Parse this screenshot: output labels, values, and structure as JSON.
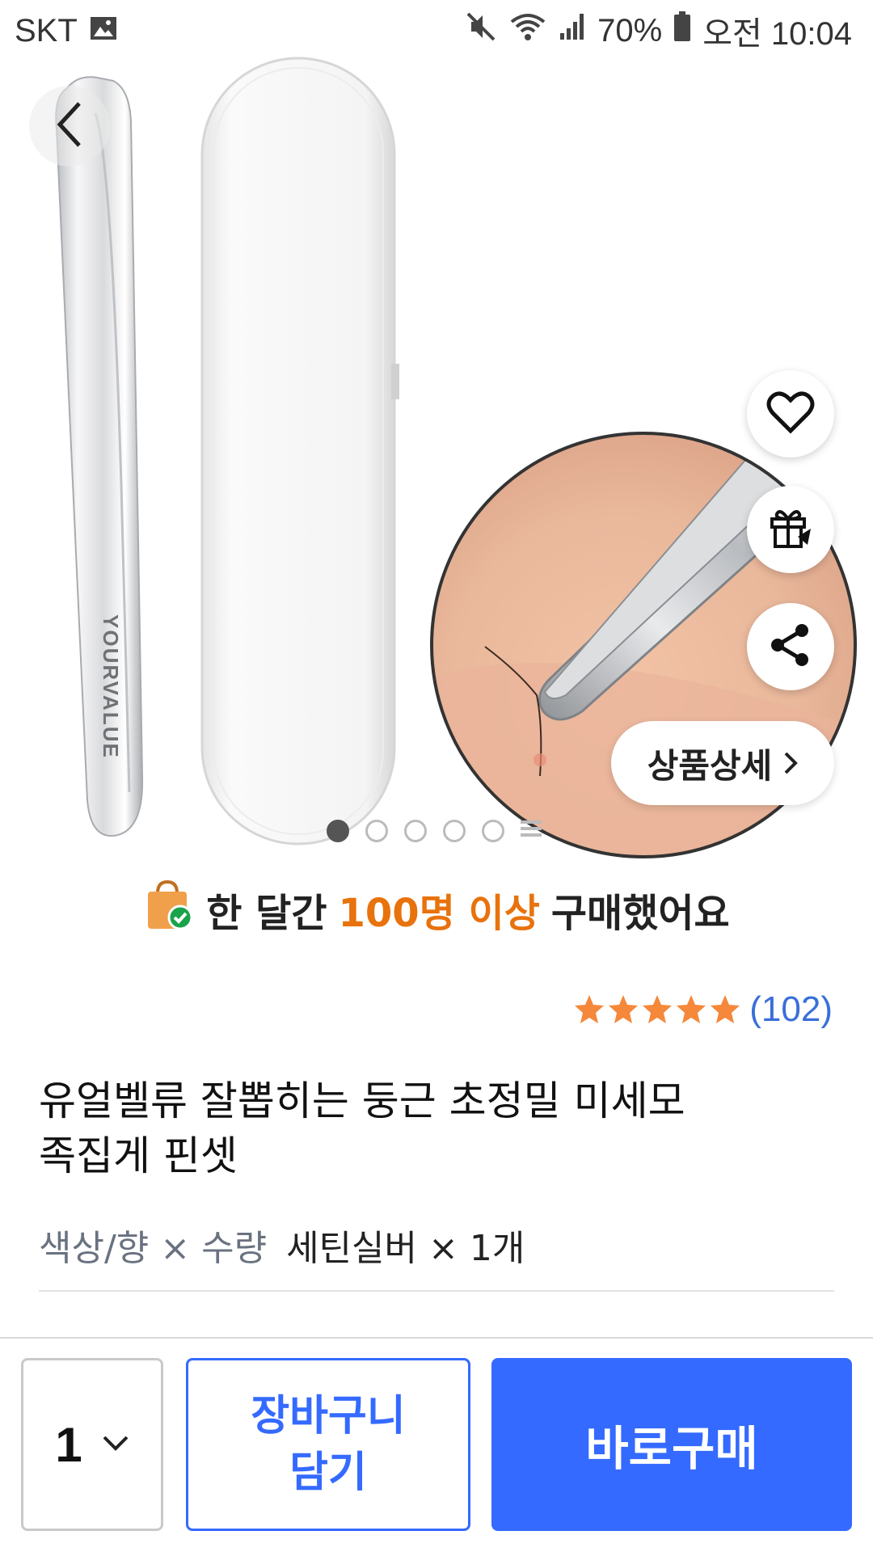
{
  "status_bar": {
    "carrier": "SKT",
    "battery": "70%",
    "time": "오전 10:04"
  },
  "product_image": {
    "brand_text": "YOURVALUE"
  },
  "floating_actions": {
    "detail_label": "상품상세"
  },
  "pager": {
    "total_shown": 5,
    "active_index": 0
  },
  "purchase_info": {
    "prefix": "한 달간",
    "highlight": "100명 이상",
    "suffix": "구매했어요"
  },
  "rating": {
    "stars": 5,
    "review_count": "(102)",
    "star_color": "#f5883a"
  },
  "product": {
    "title_line1": "유얼벨류 잘뽑히는 둥근 초정밀 미세모",
    "title_line2": "족집게 핀셋",
    "option_label": "색상/향 × 수량",
    "option_value": "세틴실버 × 1개"
  },
  "bottom_bar": {
    "quantity": "1",
    "cart_line1": "장바구니",
    "cart_line2": "담기",
    "buy_label": "바로구매",
    "accent": "#346aff"
  }
}
